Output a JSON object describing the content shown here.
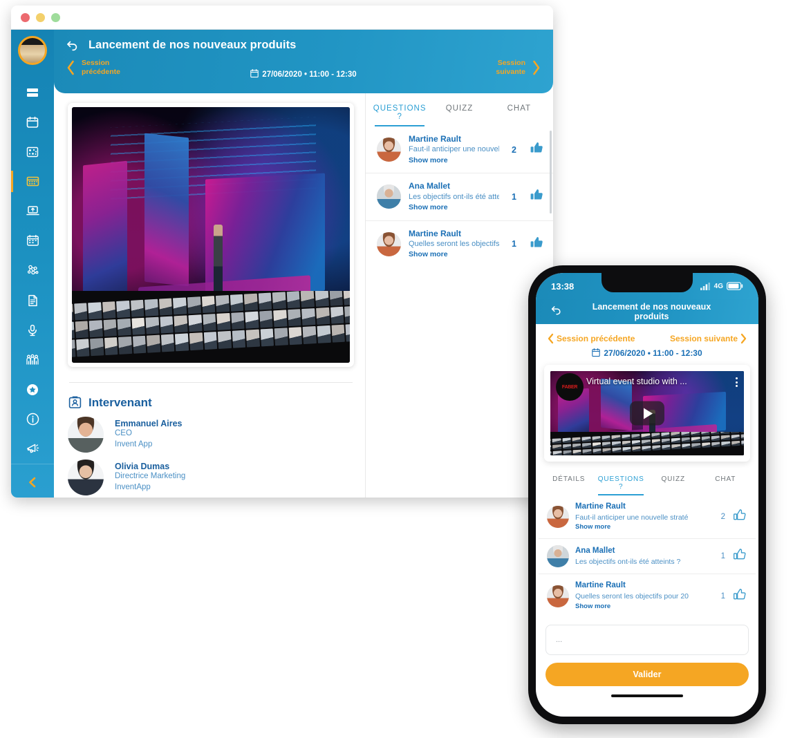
{
  "window": {
    "traffic_lights": [
      "close",
      "minimize",
      "maximize"
    ]
  },
  "sidebar": {
    "logo_name": "app-logo",
    "items": [
      {
        "id": "dashboard",
        "icon": "dashboard-icon",
        "active": false
      },
      {
        "id": "agenda",
        "icon": "calendar-icon",
        "active": false
      },
      {
        "id": "program",
        "icon": "program-grid-icon",
        "active": false
      },
      {
        "id": "sessions",
        "icon": "sessions-calendar-icon",
        "active": true
      },
      {
        "id": "workshops",
        "icon": "laptop-upload-icon",
        "active": false
      },
      {
        "id": "planning",
        "icon": "planning-board-icon",
        "active": false
      },
      {
        "id": "networking",
        "icon": "network-nodes-icon",
        "active": false
      },
      {
        "id": "documents",
        "icon": "document-icon",
        "active": false
      },
      {
        "id": "podcast",
        "icon": "microphone-icon",
        "active": false
      },
      {
        "id": "attendees",
        "icon": "people-group-icon",
        "active": false
      },
      {
        "id": "favorites",
        "icon": "star-icon",
        "active": false
      },
      {
        "id": "information",
        "icon": "info-icon",
        "active": false
      },
      {
        "id": "announcements",
        "icon": "megaphone-icon",
        "active": false
      }
    ],
    "collapse_icon": "chevron-left-icon",
    "power_icon": "power-icon"
  },
  "header": {
    "back_icon": "back-arrow-icon",
    "title": "Lancement de nos nouveaux produits",
    "prev_session": "Session\nprécédente",
    "prev_session_line1": "Session",
    "prev_session_line2": "précédente",
    "next_session_line1": "Session",
    "next_session_line2": "suivante",
    "date_icon": "calendar-icon",
    "date_text": "27/06/2020 • 11:00 - 12:30"
  },
  "video": {
    "name": "live-session-video"
  },
  "speakers": {
    "section_icon": "speaker-badge-icon",
    "section_title": "Intervenant",
    "list": [
      {
        "name": "Emmanuel Aires",
        "role": "CEO",
        "org": "Invent App"
      },
      {
        "name": "Olivia Dumas",
        "role": "Directrice Marketing",
        "org": "InventApp"
      }
    ]
  },
  "questions_panel": {
    "tabs": [
      {
        "label": "QUESTIONS ?",
        "active": true
      },
      {
        "label": "QUIZZ",
        "active": false
      },
      {
        "label": "CHAT",
        "active": false
      }
    ],
    "items": [
      {
        "author": "Martine Rault",
        "message": "Faut-il anticiper une nouvelle",
        "show_more": "Show more",
        "likes": "2",
        "like_icon": "thumbs-up-icon"
      },
      {
        "author": "Ana Mallet",
        "message": "Les objectifs ont-ils été attei",
        "show_more": "Show more",
        "likes": "1",
        "like_icon": "thumbs-up-icon"
      },
      {
        "author": "Martine Rault",
        "message": "Quelles seront les objectifs p",
        "show_more": "Show more",
        "likes": "1",
        "like_icon": "thumbs-up-icon"
      }
    ]
  },
  "phone": {
    "status": {
      "time": "13:38",
      "signal_icon": "signal-bars-icon",
      "network": "4G",
      "battery_icon": "battery-icon"
    },
    "header": {
      "back_icon": "back-arrow-icon",
      "title": "Lancement de nos nouveaux produits"
    },
    "nav": {
      "prev_icon": "chevron-left-icon",
      "prev_label": "Session précédente",
      "next_label": "Session suivante",
      "next_icon": "chevron-right-icon"
    },
    "date_icon": "calendar-icon",
    "date_text": "27/06/2020 • 11:00 - 12:30",
    "video": {
      "title": "Virtual event studio with ...",
      "channel_logo": "FABER",
      "play_icon": "play-icon",
      "menu_icon": "kebab-menu-icon"
    },
    "tabs": [
      {
        "label": "DÉTAILS",
        "active": false
      },
      {
        "label": "QUESTIONS ?",
        "active": true
      },
      {
        "label": "QUIZZ",
        "active": false
      },
      {
        "label": "CHAT",
        "active": false
      }
    ],
    "items": [
      {
        "author": "Martine Rault",
        "message": "Faut-il anticiper une nouvelle straté",
        "show_more": "Show more",
        "likes": "2",
        "like_icon": "thumbs-up-outline-icon"
      },
      {
        "author": "Ana Mallet",
        "message": "Les objectifs ont-ils été atteints ?",
        "show_more": "",
        "likes": "1",
        "like_icon": "thumbs-up-outline-icon"
      },
      {
        "author": "Martine Rault",
        "message": "Quelles seront les objectifs pour 20",
        "show_more": "Show more",
        "likes": "1",
        "like_icon": "thumbs-up-outline-icon"
      }
    ],
    "input_placeholder": "...",
    "validate_label": "Valider"
  },
  "colors": {
    "brand_blue": "#2195c4",
    "accent_orange": "#f5a623",
    "link_blue": "#1a6fb5",
    "muted_blue": "#4a8fc4",
    "tab_active": "#2b9fd4"
  }
}
